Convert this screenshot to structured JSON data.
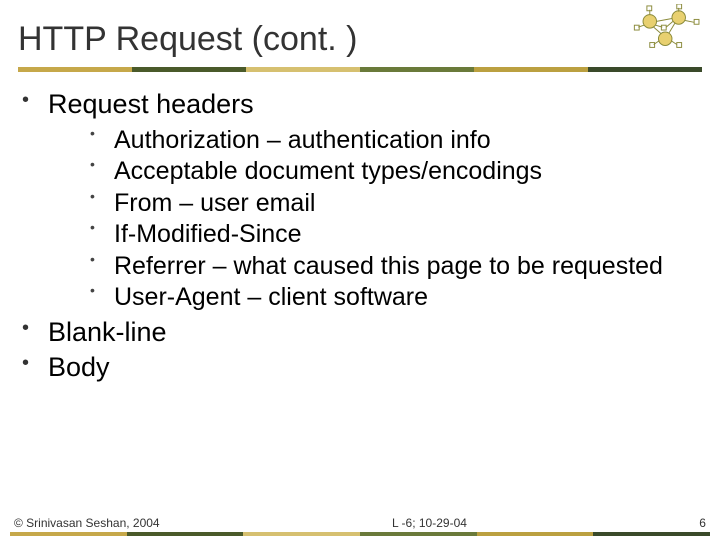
{
  "title": "HTTP Request (cont. )",
  "outer_items": [
    {
      "label": "Request headers",
      "inner": [
        "Authorization – authentication info",
        "Acceptable document types/encodings",
        "From – user email",
        "If-Modified-Since",
        "Referrer – what caused this page to be requested",
        "User-Agent – client software"
      ]
    },
    {
      "label": "Blank-line"
    },
    {
      "label": "Body"
    }
  ],
  "footer": {
    "left": "© Srinivasan Seshan, 2004",
    "center": "L -6; 10-29-04",
    "right": "6"
  }
}
